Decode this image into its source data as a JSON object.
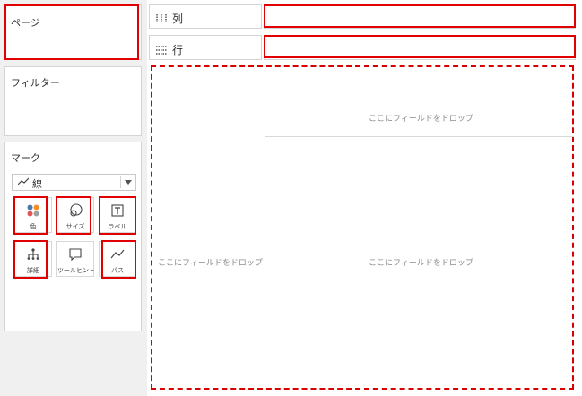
{
  "cards": {
    "pages_title": "ページ",
    "filters_title": "フィルター",
    "marks_title": "マーク"
  },
  "marks": {
    "type_label": "線",
    "type_icon": "line-chart-icon",
    "buttons": [
      {
        "label": "色",
        "icon": "color-dots-icon"
      },
      {
        "label": "サイズ",
        "icon": "size-circles-icon"
      },
      {
        "label": "ラベル",
        "icon": "label-t-icon"
      },
      {
        "label": "詳細",
        "icon": "detail-tree-icon"
      },
      {
        "label": "ツールヒント",
        "icon": "tooltip-bubble-icon"
      },
      {
        "label": "パス",
        "icon": "path-line-icon"
      }
    ]
  },
  "shelves": {
    "columns_label": "列",
    "columns_icon": "columns-icon",
    "rows_label": "行",
    "rows_icon": "rows-icon"
  },
  "canvas": {
    "drop_top": "ここにフィールドをドロップ",
    "drop_left": "ここにフィールドをドロップ",
    "drop_center": "ここにフィールドをドロップ"
  },
  "colors": {
    "highlight": "#e00000",
    "panel_bg": "#f0f0f0",
    "border": "#d4d4d4",
    "dot_blue": "#4e79a7",
    "dot_orange": "#f28e2b",
    "dot_red": "#e15759",
    "dot_gray": "#a0a0a0"
  }
}
